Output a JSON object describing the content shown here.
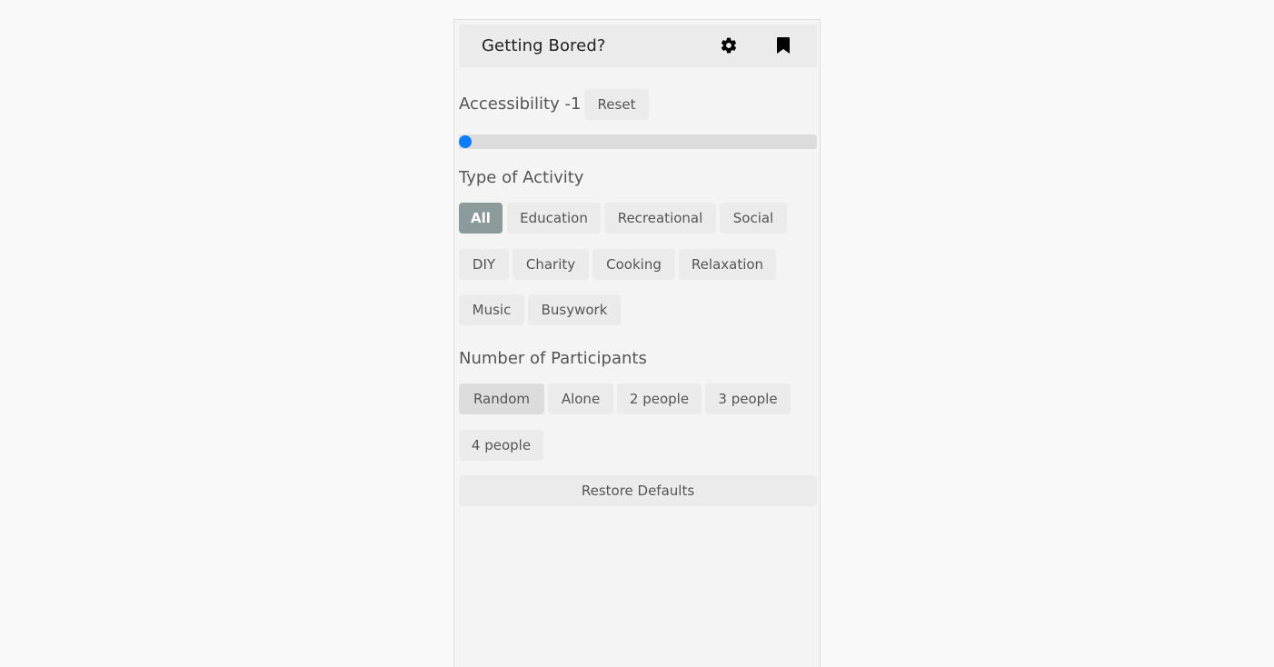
{
  "header": {
    "title": "Getting Bored?",
    "icons": [
      "gear-icon",
      "bookmark-icon"
    ]
  },
  "accessibility": {
    "label": "Accessibility -1",
    "reset_label": "Reset",
    "slider_value": 0
  },
  "activity": {
    "label": "Type of Activity",
    "selected": "All",
    "options": [
      "All",
      "Education",
      "Recreational",
      "Social",
      "DIY",
      "Charity",
      "Cooking",
      "Relaxation",
      "Music",
      "Busywork"
    ]
  },
  "participants": {
    "label": "Number of Participants",
    "selected": "Random",
    "options": [
      "Random",
      "Alone",
      "2 people",
      "3 people",
      "4 people"
    ]
  },
  "restore_label": "Restore Defaults",
  "colors": {
    "accent": "#0b7bff",
    "active_chip": "#8c9a9c"
  }
}
